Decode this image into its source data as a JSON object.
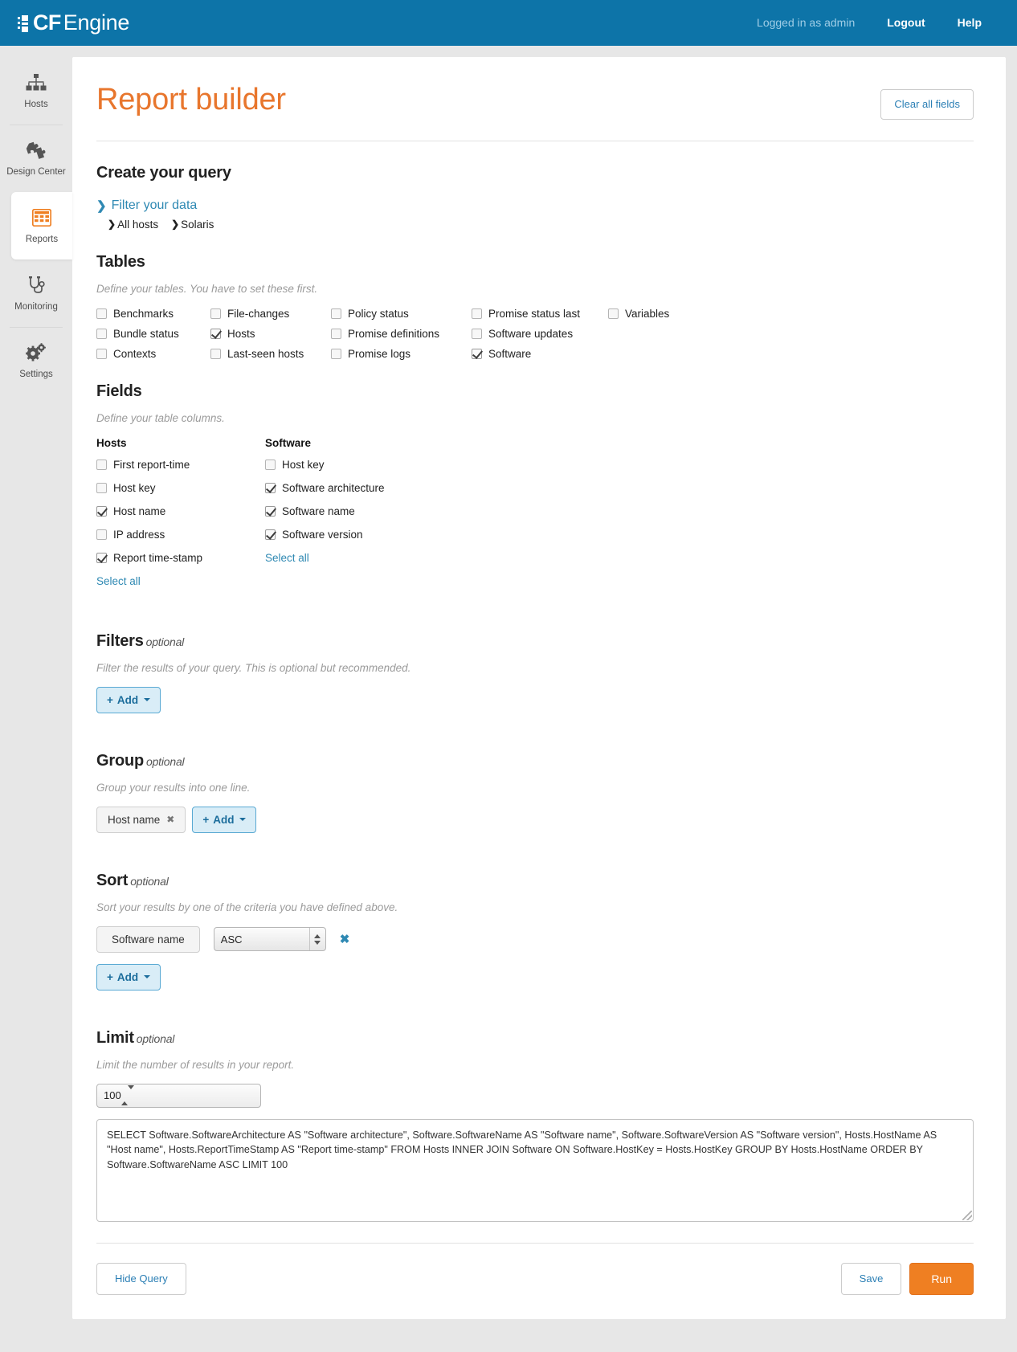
{
  "header": {
    "brand_cf": "CF",
    "brand_engine": "Engine",
    "logged_in": "Logged in as admin",
    "logout": "Logout",
    "help": "Help"
  },
  "sidebar": {
    "items": [
      {
        "label": "Hosts",
        "icon": "sitemap-icon",
        "active": false
      },
      {
        "label": "Design Center",
        "icon": "puzzle-icon",
        "active": false
      },
      {
        "label": "Reports",
        "icon": "table-grid-icon",
        "active": true
      },
      {
        "label": "Monitoring",
        "icon": "stethoscope-icon",
        "active": false
      },
      {
        "label": "Settings",
        "icon": "gears-icon",
        "active": false
      }
    ]
  },
  "page": {
    "title": "Report builder",
    "clear_all": "Clear all fields"
  },
  "query": {
    "heading": "Create your query",
    "filter_link": "Filter your data",
    "breadcrumbs": [
      "All hosts",
      "Solaris"
    ]
  },
  "tables": {
    "heading": "Tables",
    "hint": "Define your tables. You have to set these first.",
    "items": [
      {
        "label": "Benchmarks",
        "checked": false
      },
      {
        "label": "File-changes",
        "checked": false
      },
      {
        "label": "Policy status",
        "checked": false
      },
      {
        "label": "Promise status last",
        "checked": false
      },
      {
        "label": "Variables",
        "checked": false
      },
      {
        "label": "Bundle status",
        "checked": false
      },
      {
        "label": "Hosts",
        "checked": true
      },
      {
        "label": "Promise definitions",
        "checked": false
      },
      {
        "label": "Software updates",
        "checked": false
      },
      {
        "label": "",
        "checked": false
      },
      {
        "label": "Contexts",
        "checked": false
      },
      {
        "label": "Last-seen hosts",
        "checked": false
      },
      {
        "label": "Promise logs",
        "checked": false
      },
      {
        "label": "Software",
        "checked": true
      },
      {
        "label": "",
        "checked": false
      }
    ]
  },
  "fields": {
    "heading": "Fields",
    "hint": "Define your table columns.",
    "select_all": "Select all",
    "groups": [
      {
        "title": "Hosts",
        "items": [
          {
            "label": "First report-time",
            "checked": false
          },
          {
            "label": "Host key",
            "checked": false
          },
          {
            "label": "Host name",
            "checked": true
          },
          {
            "label": "IP address",
            "checked": false
          },
          {
            "label": "Report time-stamp",
            "checked": true
          }
        ]
      },
      {
        "title": "Software",
        "items": [
          {
            "label": "Host key",
            "checked": false
          },
          {
            "label": "Software architecture",
            "checked": true
          },
          {
            "label": "Software name",
            "checked": true
          },
          {
            "label": "Software version",
            "checked": true
          }
        ]
      }
    ]
  },
  "filters": {
    "heading": "Filters",
    "optional": "optional",
    "hint": "Filter the results of your query. This is optional but recommended.",
    "add_label": "Add"
  },
  "group": {
    "heading": "Group",
    "optional": "optional",
    "hint": "Group your results into one line.",
    "tags": [
      "Host name"
    ],
    "add_label": "Add"
  },
  "sort": {
    "heading": "Sort",
    "optional": "optional",
    "hint": "Sort your results by one of the criteria you have defined above.",
    "field": "Software name",
    "direction": "ASC",
    "add_label": "Add"
  },
  "limit": {
    "heading": "Limit",
    "optional": "optional",
    "hint": "Limit the number of results in your report.",
    "value": "100"
  },
  "sql": {
    "text": "SELECT Software.SoftwareArchitecture AS \"Software architecture\", Software.SoftwareName AS \"Software name\", Software.SoftwareVersion AS \"Software version\", Hosts.HostName AS \"Host name\", Hosts.ReportTimeStamp AS \"Report time-stamp\" FROM Hosts INNER JOIN Software ON Software.HostKey = Hosts.HostKey GROUP BY Hosts.HostName ORDER BY Software.SoftwareName ASC LIMIT 100"
  },
  "footer": {
    "hide_query": "Hide Query",
    "save": "Save",
    "run": "Run"
  },
  "colors": {
    "brand_blue": "#0d74a8",
    "accent_orange": "#e8762d",
    "run_orange": "#ef7f22",
    "link_blue": "#2f89b3"
  }
}
